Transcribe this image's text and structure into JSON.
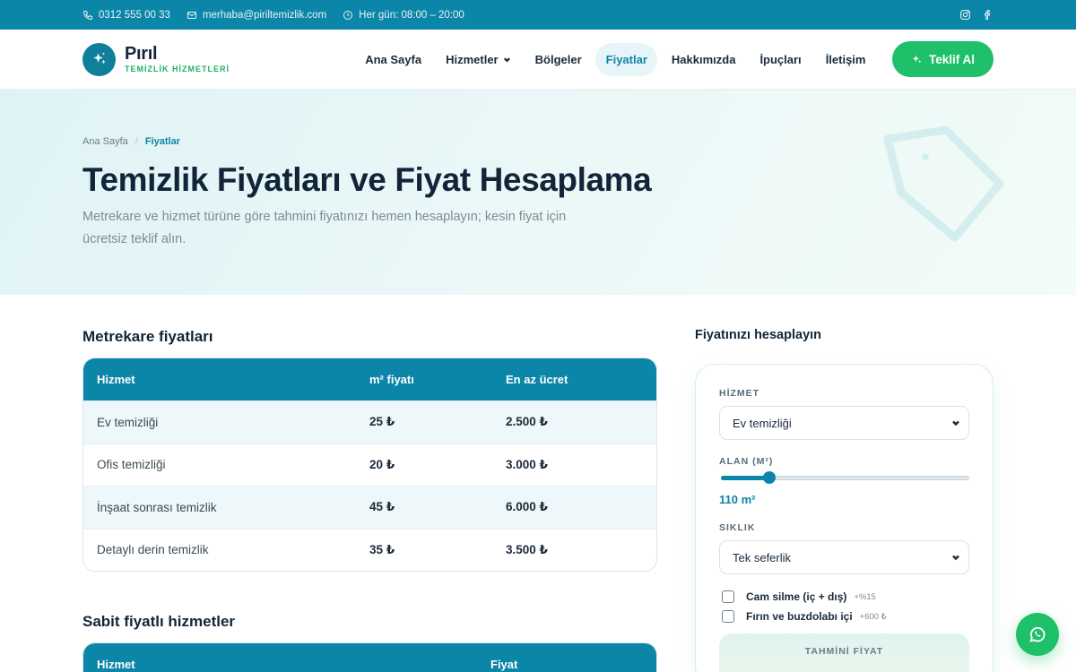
{
  "topbar": {
    "phone": "0312 555 00 33",
    "email": "merhaba@piriltemizlik.com",
    "hours": "Her gün: 08:00 – 20:00",
    "social": [
      "instagram-icon",
      "facebook-icon"
    ]
  },
  "brand": {
    "name": "Pırıl",
    "tagline": "TEMİZLİK HİZMETLERİ"
  },
  "nav": {
    "items": [
      "Ana Sayfa",
      "Hizmetler",
      "Bölgeler",
      "Fiyatlar",
      "Hakkımızda",
      "İpuçları",
      "İletişim"
    ],
    "active": "Fiyatlar",
    "cta": "Teklif Al"
  },
  "hero": {
    "breadcrumb": [
      "Ana Sayfa",
      "/",
      "Fiyatlar"
    ],
    "title": "Temizlik Fiyatları ve Fiyat Hesaplama",
    "subtitle": "Metrekare ve hizmet türüne göre tahmini fiyatınızı hemen hesaplayın; kesin fiyat için ücretsiz teklif alın."
  },
  "sqm_prices": {
    "title": "Metrekare fiyatları",
    "headers": [
      "Hizmet",
      "m² fiyatı",
      "En az ücret"
    ],
    "rows": [
      [
        "Ev temizliği",
        "25 ₺",
        "2.500 ₺"
      ],
      [
        "Ofis temizliği",
        "20 ₺",
        "3.000 ₺"
      ],
      [
        "İnşaat sonrası temizlik",
        "45 ₺",
        "6.000 ₺"
      ],
      [
        "Detaylı derin temizlik",
        "35 ₺",
        "3.500 ₺"
      ]
    ]
  },
  "fixed_prices": {
    "title": "Sabit fiyatlı hizmetler",
    "headers": [
      "Hizmet",
      "Fiyat"
    ]
  },
  "calculator": {
    "title": "Fiyatınızı hesaplayın",
    "service_label": "HİZMET",
    "service_value": "Ev temizliği",
    "area_label": "ALAN (M²)",
    "area_value": "110 m²",
    "area_fraction": 0.2,
    "frequency_label": "SIKLIK",
    "frequency_value": "Tek seferlik",
    "extras": [
      {
        "label": "Cam silme (iç + dış)",
        "price": "+%15",
        "checked": false
      },
      {
        "label": "Fırın ve buzdolabı içi",
        "price": "+600 ₺",
        "checked": false
      }
    ],
    "result_label": "TAHMİNİ FİYAT"
  },
  "colors": {
    "primary": "#0c86a8",
    "accent": "#1fc06a",
    "heading": "#122538"
  }
}
